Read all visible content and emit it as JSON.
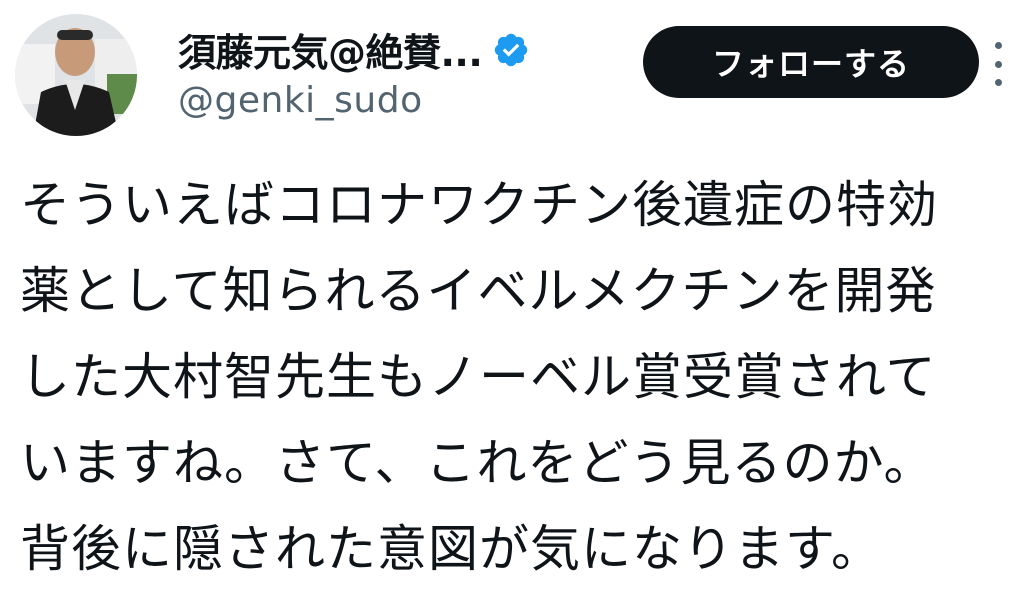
{
  "author": {
    "display_name": "須藤元気@絶賛...",
    "handle": "@genki_sudo",
    "verified_icon": "verified-badge-icon",
    "avatar_icon": "avatar-photo"
  },
  "follow_button": {
    "label": "フォローする"
  },
  "more_menu": {
    "icon": "more-vertical-icon"
  },
  "tweet": {
    "lines": [
      "そういえばコロナワクチン後遺症の特効",
      "薬として知られるイベルメクチンを開発",
      "した大村智先生もノーベル賞受賞されて",
      "いますね。さて、これをどう見るのか。",
      "背後に隠された意図が気になります。"
    ]
  },
  "colors": {
    "text": "#0f1419",
    "secondary": "#536471",
    "button_bg": "#0f1419",
    "verified": "#1d9bf0"
  }
}
